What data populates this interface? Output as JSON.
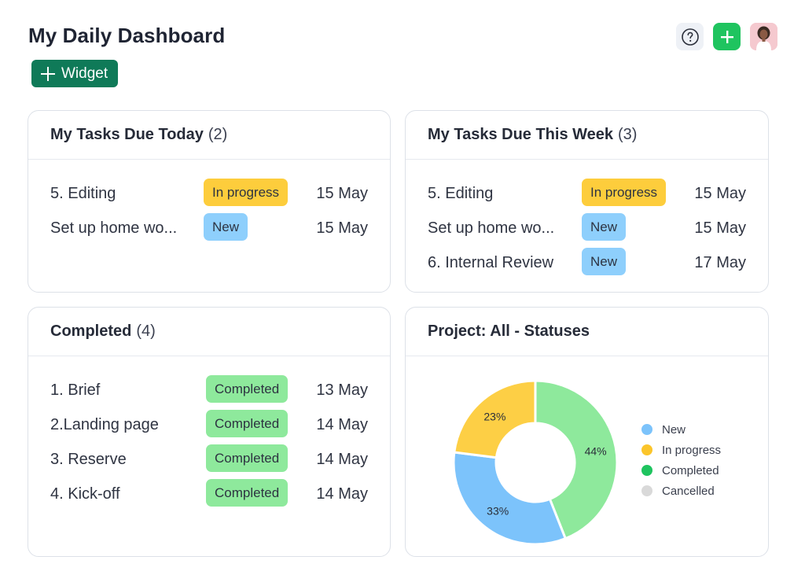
{
  "header": {
    "title": "My Daily Dashboard"
  },
  "toolbar": {
    "widget_label": "Widget"
  },
  "top_actions": {
    "help_icon": "question-circle-icon",
    "add_icon": "plus-icon",
    "avatar": "user-avatar"
  },
  "colors": {
    "accent": "#0f7a58",
    "add_button": "#1fc45f",
    "status_new": "#8ecffc",
    "status_in_progress": "#fdcd3c",
    "status_completed": "#8ee99c",
    "status_cancelled": "#d9d9d9"
  },
  "cards": {
    "today": {
      "title": "My Tasks Due Today",
      "count": "(2)",
      "tasks": [
        {
          "name": "5. Editing",
          "status": "In progress",
          "date": "15 May"
        },
        {
          "name": "Set up home wo...",
          "status": "New",
          "date": "15 May"
        }
      ]
    },
    "week": {
      "title": "My Tasks Due This Week",
      "count": "(3)",
      "tasks": [
        {
          "name": "5. Editing",
          "status": "In progress",
          "date": "15 May"
        },
        {
          "name": "Set up home wo...",
          "status": "New",
          "date": "15 May"
        },
        {
          "name": "6. Internal Review",
          "status": "New",
          "date": "17 May"
        }
      ]
    },
    "completed": {
      "title": "Completed",
      "count": "(4)",
      "tasks": [
        {
          "name": "1. Brief",
          "status": "Completed",
          "date": "13 May"
        },
        {
          "name": "2.Landing page",
          "status": "Completed",
          "date": "14 May"
        },
        {
          "name": "3. Reserve",
          "status": "Completed",
          "date": "14 May"
        },
        {
          "name": "4. Kick-off",
          "status": "Completed",
          "date": "14 May"
        }
      ]
    },
    "statuses": {
      "title": "Project: All - Statuses"
    }
  },
  "chart_data": {
    "type": "pie",
    "donut": true,
    "title": "Project: All - Statuses",
    "categories": [
      "New",
      "In progress",
      "Completed",
      "Cancelled"
    ],
    "values": [
      33,
      23,
      44,
      0
    ],
    "value_labels": [
      "33%",
      "23%",
      "44%",
      ""
    ],
    "colors": [
      "#7cc3fb",
      "#fdcf45",
      "#8ee99c",
      "#d9d9d9"
    ],
    "legend_dot_colors": [
      "#7cc3fb",
      "#fbc52b",
      "#1fc45f",
      "#d9d9d9"
    ],
    "legend_position": "right"
  }
}
